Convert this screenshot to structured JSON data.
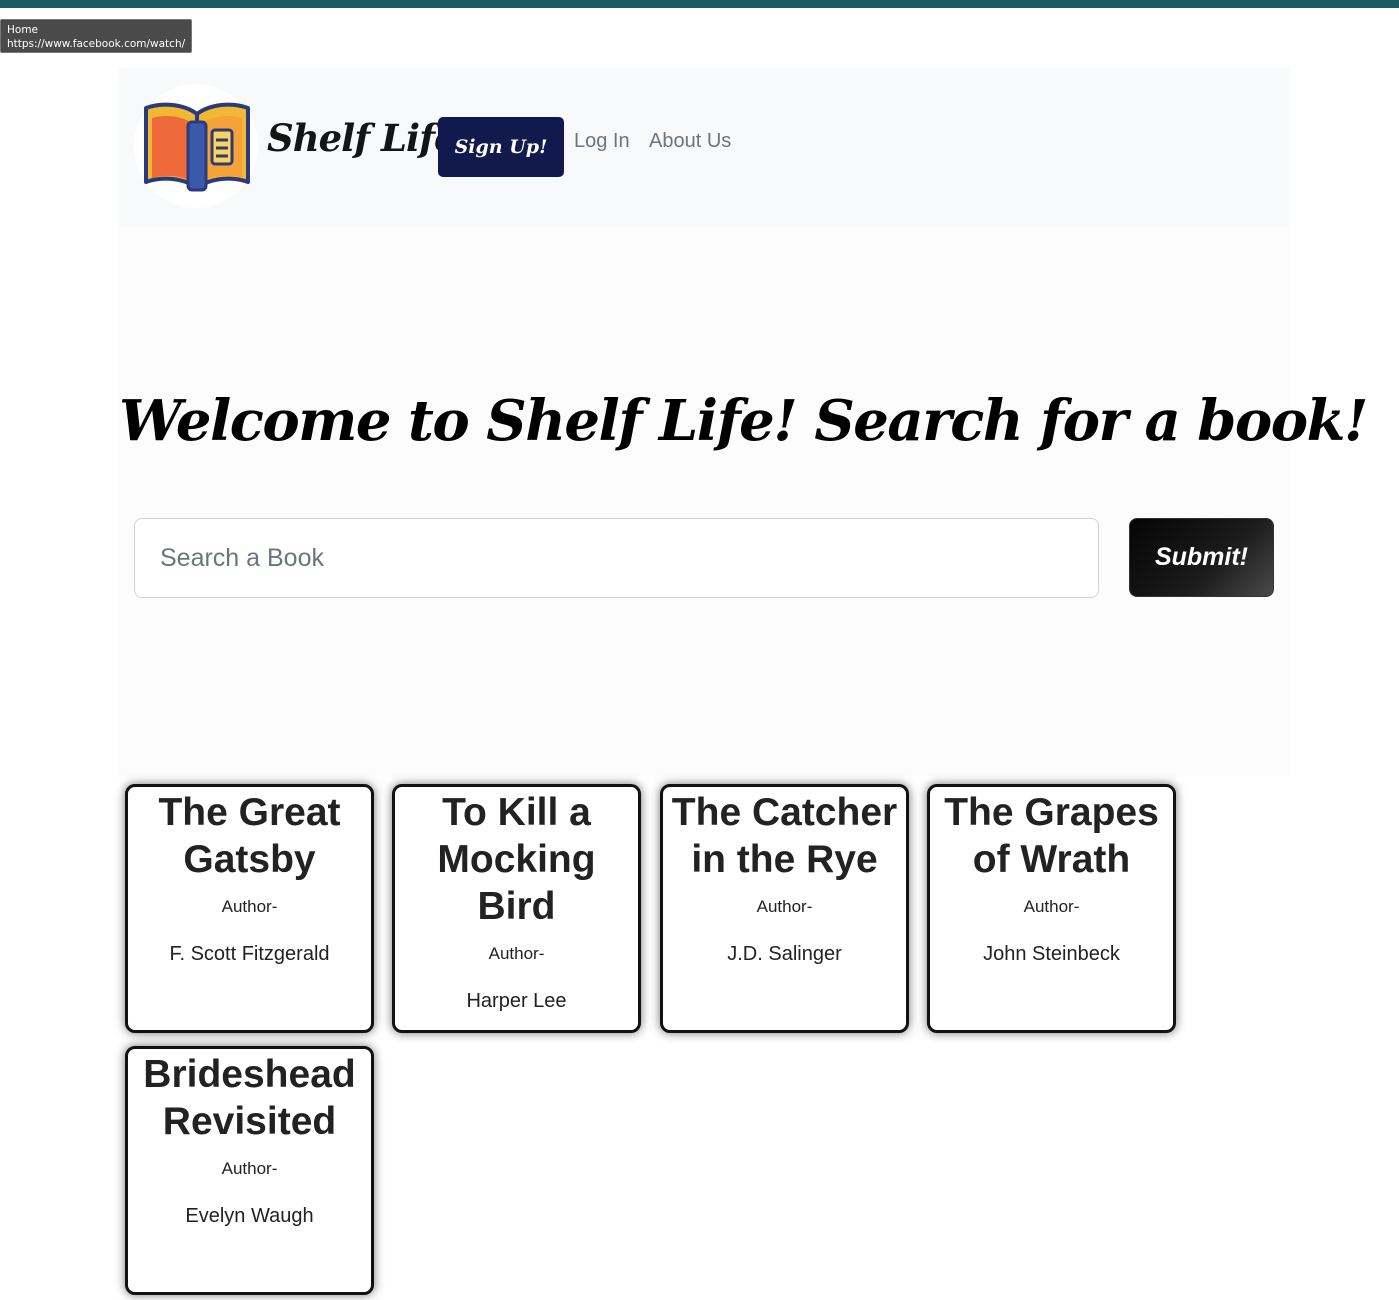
{
  "tooltip": {
    "title": "Home",
    "url": "https://www.facebook.com/watch/"
  },
  "navbar": {
    "brand": "Shelf Life",
    "logo_icon": "open-book-icon",
    "signup_label": "Sign Up!",
    "login_label": "Log In",
    "about_label": "About Us"
  },
  "hero": {
    "title": "Welcome to Shelf Life! Search for a book!",
    "search_placeholder": "Search a Book",
    "submit_label": "Submit!"
  },
  "books": [
    {
      "title": "The Great Gatsby",
      "author_label": "Author-",
      "author": "F. Scott Fitzgerald"
    },
    {
      "title": "To Kill a Mocking Bird",
      "author_label": "Author-",
      "author": "Harper Lee"
    },
    {
      "title": "The Catcher in the Rye",
      "author_label": "Author-",
      "author": "J.D. Salinger"
    },
    {
      "title": "The Grapes of Wrath",
      "author_label": "Author-",
      "author": "John Steinbeck"
    },
    {
      "title": "Brideshead Revisited",
      "author_label": "Author-",
      "author": "Evelyn Waugh"
    }
  ],
  "colors": {
    "topbar": "#1b5a60",
    "signup_bg": "#12194d",
    "navbar_bg": "#f8f9fa"
  }
}
